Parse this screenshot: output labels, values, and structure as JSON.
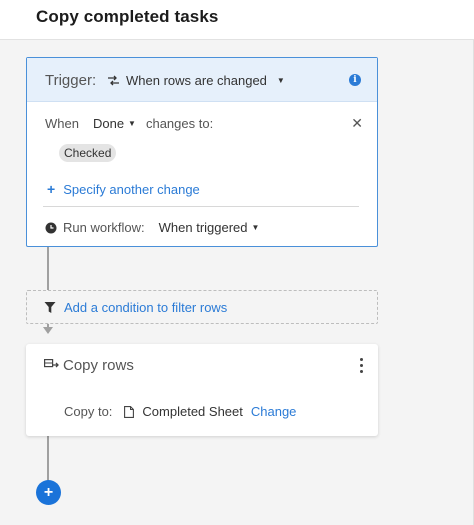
{
  "header": {
    "title": "Copy completed tasks"
  },
  "trigger": {
    "label": "Trigger:",
    "event": "When rows are changed",
    "when_label": "When",
    "field": "Done",
    "changes_to_label": "changes to:",
    "value_chip": "Checked",
    "add_change_label": "Specify another change",
    "run_label": "Run workflow:",
    "run_value": "When triggered"
  },
  "condition": {
    "label": "Add a condition to filter rows"
  },
  "action": {
    "title": "Copy rows",
    "copy_to_label": "Copy to:",
    "sheet_name": "Completed Sheet",
    "change_label": "Change"
  },
  "add_step": {
    "label": "+"
  },
  "colors": {
    "accent": "#2b7bd6",
    "trigger_header_bg": "#e6f0fb",
    "trigger_border": "#4a90d9",
    "add_step_bg": "#1a73d9"
  }
}
